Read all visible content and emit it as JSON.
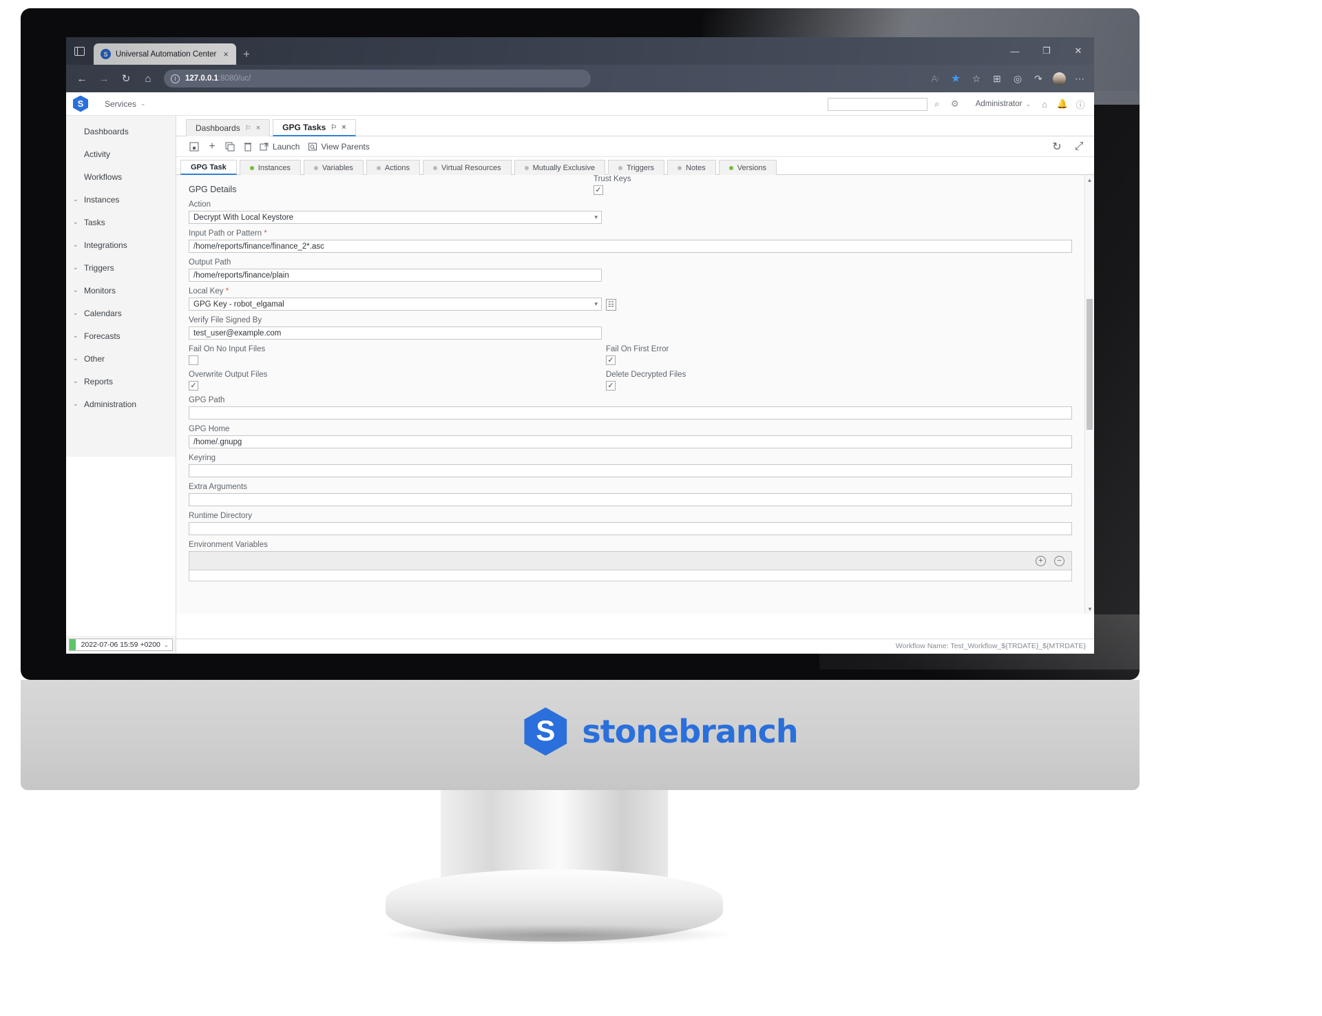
{
  "browser": {
    "tab_title": "Universal Automation Center",
    "favicon_letter": "S",
    "tab_close": "×",
    "new_tab": "+",
    "url_host": "127.0.0.1",
    "url_path": ":8080/uc/",
    "window_minimize": "—",
    "window_restore": "❐",
    "window_close": "✕",
    "nav_back": "←",
    "nav_forward": "→",
    "nav_reload": "↻",
    "nav_home": "⌂",
    "info_icon": "i",
    "right_icons": [
      "A",
      "★",
      "☆",
      "⊞",
      "◎",
      "↱",
      "avatar",
      "⋯"
    ]
  },
  "app_header": {
    "logo_letter": "S",
    "services_label": "Services",
    "caret": "⌄",
    "search_placeholder": "",
    "search_value": "",
    "search_icon": "⌕",
    "gear_icon": "⚙",
    "user_label": "Administrator",
    "home_icon": "⌂",
    "bell_icon": "♩",
    "help_icon": "?"
  },
  "sidebar": {
    "items": [
      {
        "label": "Dashboards",
        "expandable": false
      },
      {
        "label": "Activity",
        "expandable": false
      },
      {
        "label": "Workflows",
        "expandable": false
      },
      {
        "label": "Instances",
        "expandable": true
      },
      {
        "label": "Tasks",
        "expandable": true
      },
      {
        "label": "Integrations",
        "expandable": true
      },
      {
        "label": "Triggers",
        "expandable": true
      },
      {
        "label": "Monitors",
        "expandable": true
      },
      {
        "label": "Calendars",
        "expandable": true
      },
      {
        "label": "Forecasts",
        "expandable": true
      },
      {
        "label": "Other",
        "expandable": true
      },
      {
        "label": "Reports",
        "expandable": true
      },
      {
        "label": "Administration",
        "expandable": true
      }
    ],
    "arrow": "⌄",
    "date_value": "2022-07-06 15:59 +0200",
    "date_caret": "⌄"
  },
  "main_tabs": [
    {
      "label": "Dashboards",
      "active": false,
      "pin": "⚐",
      "close": "×"
    },
    {
      "label": "GPG Tasks",
      "active": true,
      "pin": "⚐",
      "close": "×"
    }
  ],
  "toolbar": {
    "save_icon": "▣",
    "new_icon": "+",
    "copy_icon": "❐",
    "delete_icon": "Ὕ1",
    "launch_icon": "↗",
    "launch_label": "Launch",
    "view_parents_icon": "⌕",
    "view_parents_label": "View Parents",
    "refresh_icon": "↻",
    "expand_icon": "⤢"
  },
  "sub_tabs": [
    {
      "label": "GPG Task",
      "active": true,
      "dot": "none"
    },
    {
      "label": "Instances",
      "active": false,
      "dot": "green"
    },
    {
      "label": "Variables",
      "active": false,
      "dot": "grey"
    },
    {
      "label": "Actions",
      "active": false,
      "dot": "grey"
    },
    {
      "label": "Virtual Resources",
      "active": false,
      "dot": "grey"
    },
    {
      "label": "Mutually Exclusive",
      "active": false,
      "dot": "grey"
    },
    {
      "label": "Triggers",
      "active": false,
      "dot": "grey"
    },
    {
      "label": "Notes",
      "active": false,
      "dot": "grey"
    },
    {
      "label": "Versions",
      "active": false,
      "dot": "green"
    }
  ],
  "form": {
    "section_title": "GPG Details",
    "action": {
      "label": "Action",
      "value": "Decrypt With Local Keystore",
      "required": false
    },
    "input_path": {
      "label": "Input Path or Pattern",
      "value": "/home/reports/finance/finance_2*.asc",
      "required": true
    },
    "output_path": {
      "label": "Output Path",
      "value": "/home/reports/finance/plain",
      "required": false
    },
    "local_key": {
      "label": "Local Key",
      "value": "GPG Key - robot_elgamal",
      "required": true
    },
    "trust_keys": {
      "label": "Trust Keys",
      "checked": true
    },
    "verify_signed_by": {
      "label": "Verify File Signed By",
      "value": "test_user@example.com",
      "required": false
    },
    "fail_no_input": {
      "label": "Fail On No Input Files",
      "checked": false
    },
    "fail_first_error": {
      "label": "Fail On First Error",
      "checked": true
    },
    "overwrite_output": {
      "label": "Overwrite Output Files",
      "checked": true
    },
    "delete_decrypted": {
      "label": "Delete Decrypted Files",
      "checked": true
    },
    "gpg_path": {
      "label": "GPG Path",
      "value": "",
      "required": false
    },
    "gpg_home": {
      "label": "GPG Home",
      "value": "/home/.gnupg",
      "required": false
    },
    "keyring": {
      "label": "Keyring",
      "value": "",
      "required": false
    },
    "extra_arguments": {
      "label": "Extra Arguments",
      "value": "",
      "required": false
    },
    "runtime_directory": {
      "label": "Runtime Directory",
      "value": "",
      "required": false
    },
    "environment_variables": {
      "label": "Environment Variables",
      "add_icon": "+",
      "remove_icon": "−"
    },
    "required_marker": "*",
    "checked_glyph": "✓",
    "picker_glyph": "☷"
  },
  "status_bar": {
    "workflow_name": "Workflow Name: Test_Workflow_${TRDATE}_${MTRDATE}"
  },
  "monitor": {
    "brand_letter": "S",
    "brand_name": "stonebranch"
  },
  "colors": {
    "accent": "#2f7fd6",
    "brand": "#2a6fdb",
    "required": "#e0564a",
    "status_green": "#6fbf3a",
    "date_green": "#5ec46a"
  }
}
